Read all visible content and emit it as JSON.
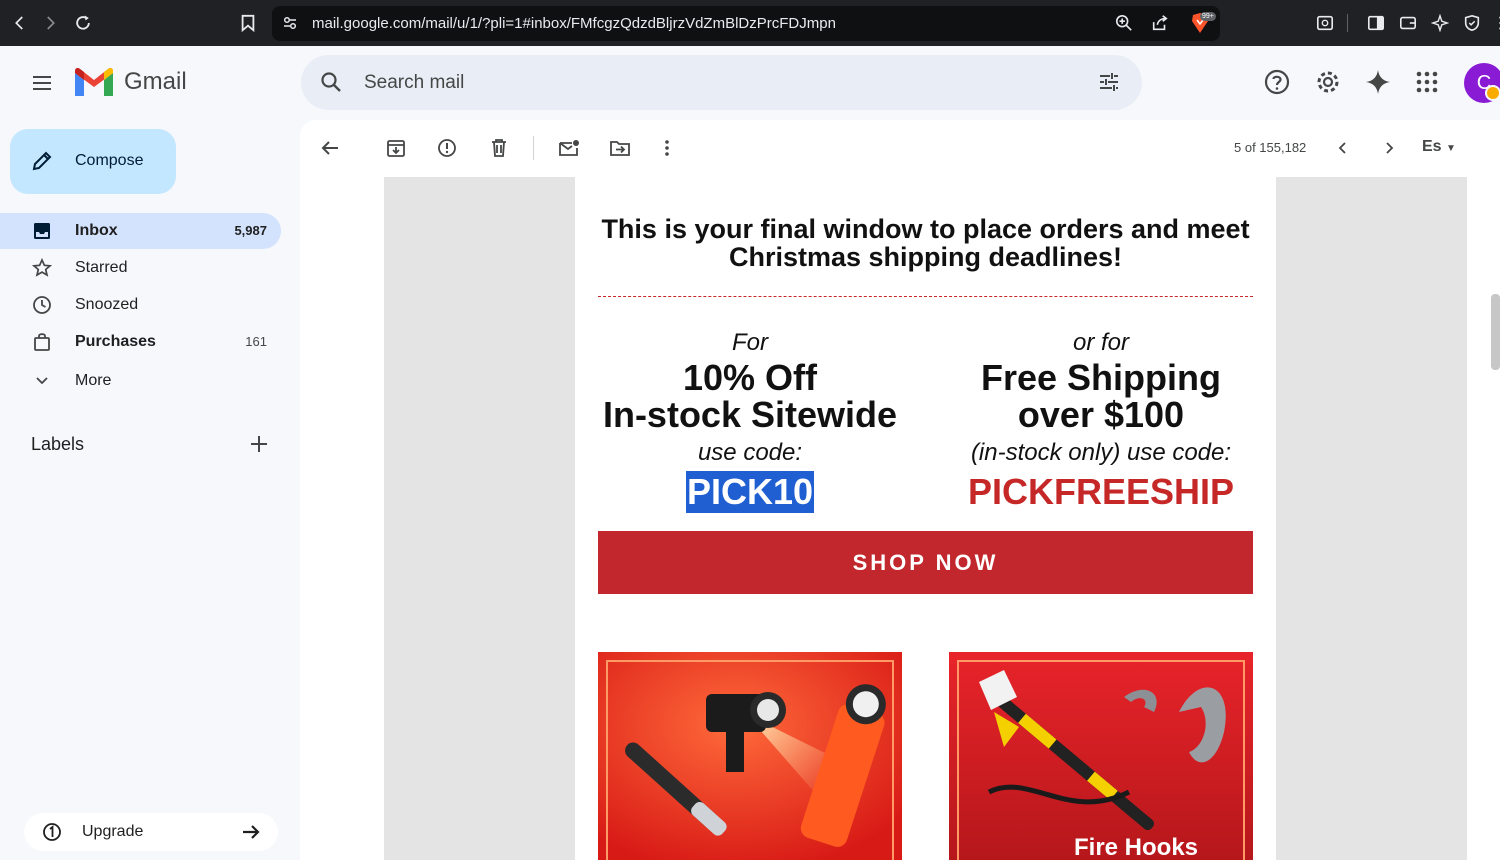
{
  "browser": {
    "url": "mail.google.com/mail/u/1/?pli=1#inbox/FMfcgzQdzdBljrzVdZmBlDzPrcFDJmpn",
    "brave_badge": "99+"
  },
  "header": {
    "app_name": "Gmail",
    "search_placeholder": "Search mail",
    "avatar_initial": "C"
  },
  "sidebar": {
    "compose_label": "Compose",
    "items": [
      {
        "label": "Inbox",
        "count": "5,987",
        "icon": "inbox-icon",
        "active": true,
        "bold": true
      },
      {
        "label": "Starred",
        "count": "",
        "icon": "star-icon",
        "active": false,
        "bold": false
      },
      {
        "label": "Snoozed",
        "count": "",
        "icon": "clock-icon",
        "active": false,
        "bold": false
      },
      {
        "label": "Purchases",
        "count": "161",
        "icon": "shopping-bag-icon",
        "active": false,
        "bold": true
      },
      {
        "label": "More",
        "count": "",
        "icon": "chevron-down-icon",
        "active": false,
        "bold": false
      }
    ],
    "labels_title": "Labels",
    "upgrade_label": "Upgrade"
  },
  "toolbar": {
    "pager": "5 of 155,182",
    "language": "Es"
  },
  "email": {
    "headline_line1": "This is your final window to place orders and meet",
    "headline_line2": "Christmas shipping deadlines!",
    "offer1": {
      "lead": "For",
      "line1": "10% Off",
      "line2": "In-stock Sitewide",
      "code_label": "use code:",
      "code": "PICK10"
    },
    "offer2": {
      "lead": "or for",
      "line1": "Free Shipping",
      "line2": "over $100",
      "code_label": "(in-stock only) use code:",
      "code": "PICKFREESHIP"
    },
    "cta": "SHOP NOW",
    "product2_caption": "Fire Hooks"
  },
  "colors": {
    "accent_red": "#c1272d",
    "selection_blue": "#1f5fd1",
    "inbox_active": "#d3e3fd",
    "compose_bg": "#c2e7ff"
  }
}
